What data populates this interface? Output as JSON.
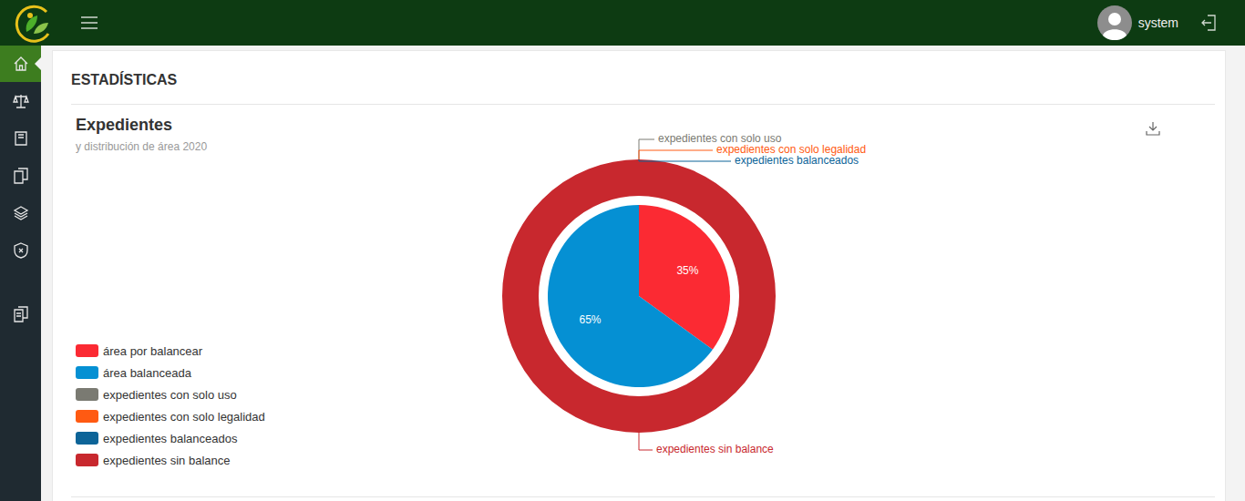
{
  "topbar": {
    "user": "system"
  },
  "sidebar": {
    "items": [
      {
        "selected": true
      },
      {
        "selected": false
      },
      {
        "selected": false
      },
      {
        "selected": false
      },
      {
        "selected": false
      },
      {
        "selected": false
      },
      {
        "selected": false
      }
    ]
  },
  "page": {
    "title": "ESTADÍSTICAS"
  },
  "chart": {
    "title": "Expedientes",
    "subtitle": "y distribución de área 2020",
    "inner": [
      {
        "name": "área por balancear",
        "value": 35,
        "label": "35%",
        "color": "#fb2a33"
      },
      {
        "name": "área balanceada",
        "value": 65,
        "label": "65%",
        "color": "#0590d3"
      }
    ],
    "outer": [
      {
        "name": "expedientes con solo uso",
        "value": 0,
        "color": "#7a7a72"
      },
      {
        "name": "expedientes con solo legalidad",
        "value": 0,
        "color": "#ff5a12"
      },
      {
        "name": "expedientes balanceados",
        "value": 0,
        "color": "#0d6498"
      },
      {
        "name": "expedientes sin balance",
        "value": 100,
        "color": "#c8282e"
      }
    ]
  }
}
